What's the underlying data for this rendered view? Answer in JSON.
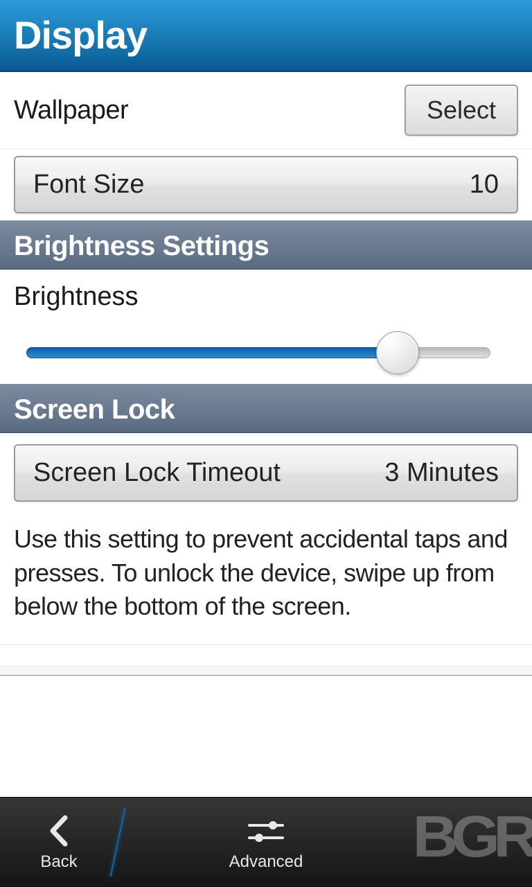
{
  "header": {
    "title": "Display"
  },
  "wallpaper": {
    "label": "Wallpaper",
    "button": "Select"
  },
  "fontsize": {
    "label": "Font Size",
    "value": "10"
  },
  "sections": {
    "brightness_header": "Brightness Settings",
    "screenlock_header": "Screen Lock"
  },
  "brightness": {
    "label": "Brightness",
    "percent": 80
  },
  "screenlock": {
    "label": "Screen Lock Timeout",
    "value": "3 Minutes",
    "description": "Use this setting to prevent accidental taps and presses. To unlock the device, swipe up from below the bottom of the screen."
  },
  "bottom": {
    "back": "Back",
    "advanced": "Advanced"
  },
  "watermark": "BGR"
}
